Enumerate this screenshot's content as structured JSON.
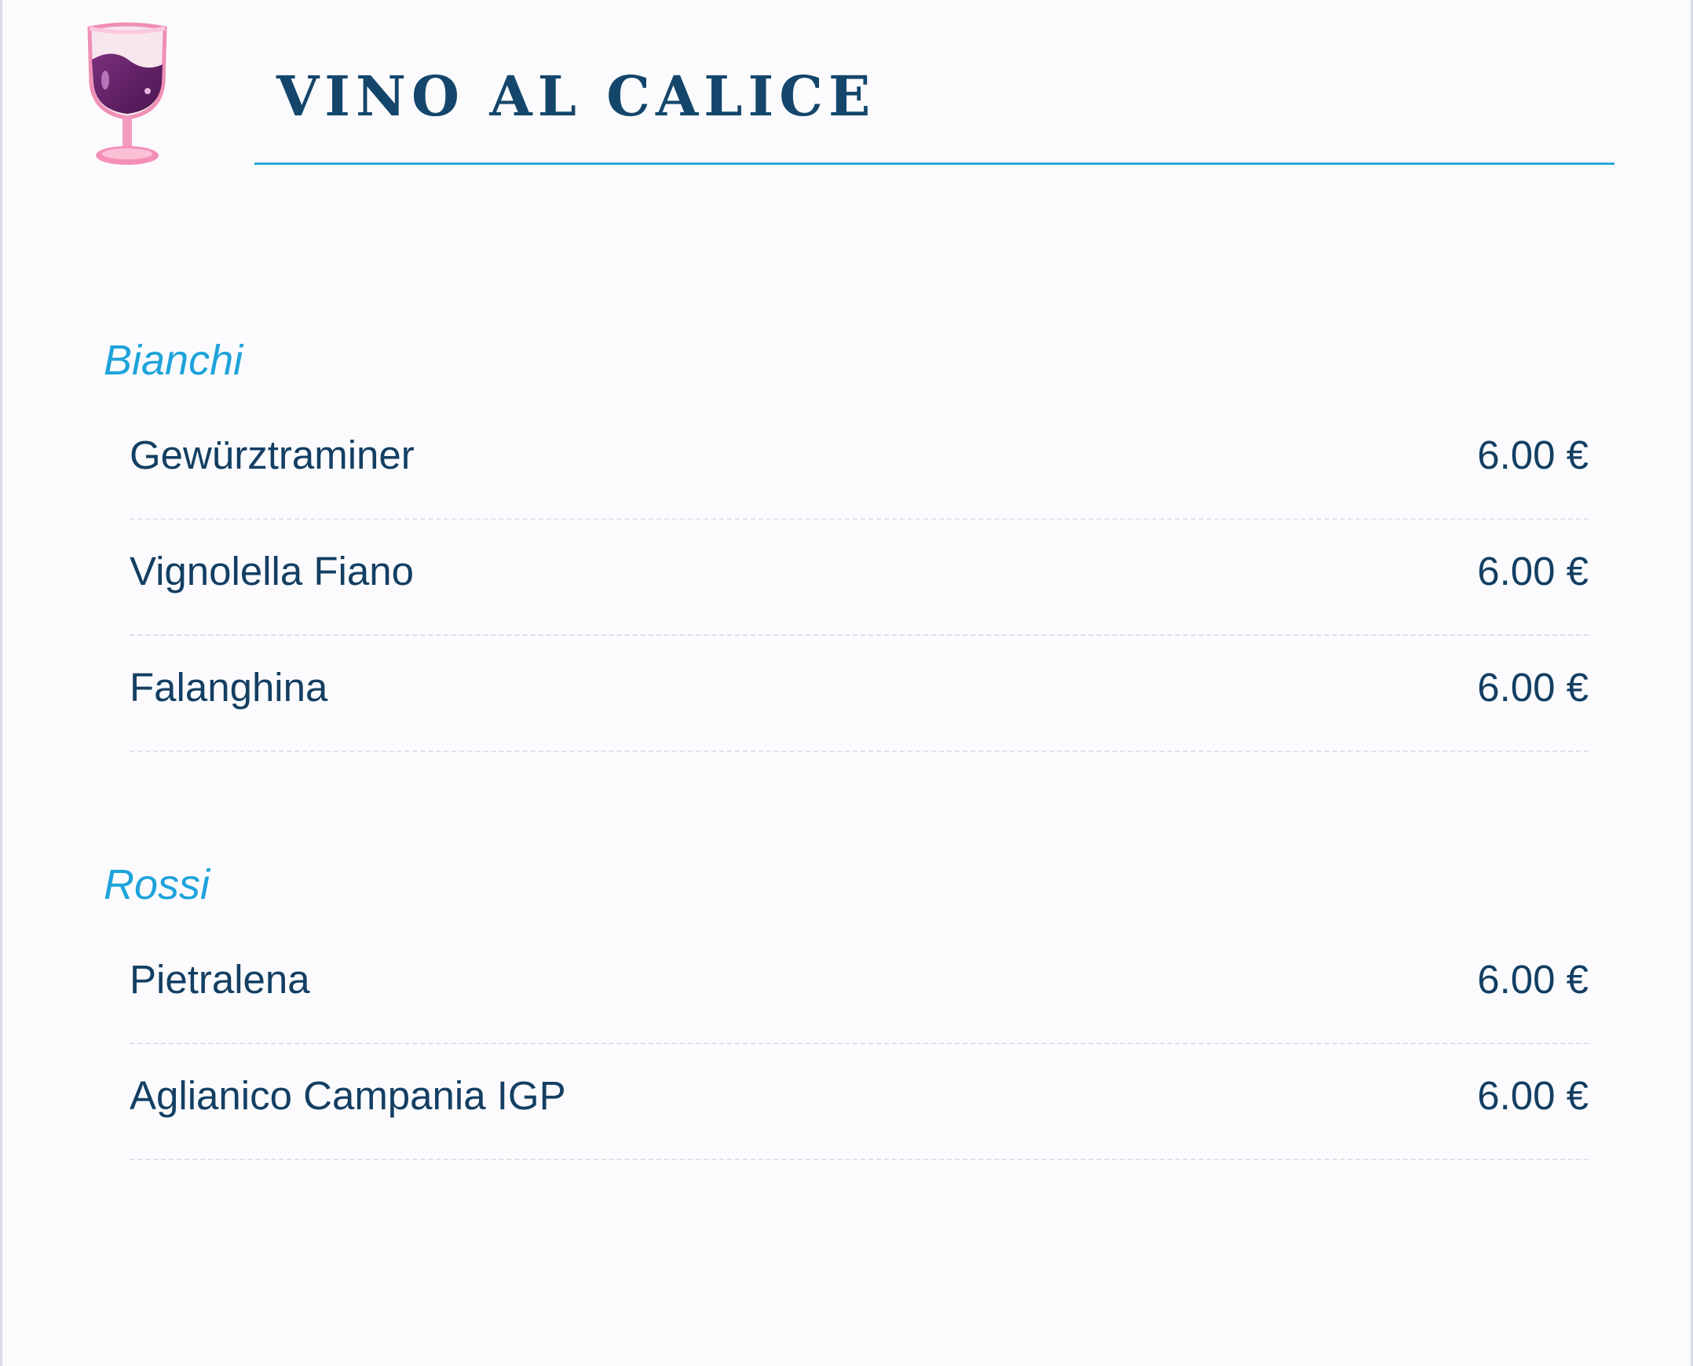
{
  "header": {
    "title": "VINO AL CALICE",
    "icon": "wine-glass-icon"
  },
  "colors": {
    "title": "#14466b",
    "accent": "#1ea3db",
    "text": "#133f63",
    "divider": "#dde1e7"
  },
  "sections": [
    {
      "title": "Bianchi",
      "items": [
        {
          "name": "Gewürztraminer",
          "price": "6.00 €"
        },
        {
          "name": "Vignolella Fiano",
          "price": "6.00 €"
        },
        {
          "name": "Falanghina",
          "price": "6.00 €"
        }
      ]
    },
    {
      "title": "Rossi",
      "items": [
        {
          "name": "Pietralena",
          "price": "6.00 €"
        },
        {
          "name": "Aglianico Campania IGP",
          "price": "6.00 €"
        }
      ]
    }
  ]
}
